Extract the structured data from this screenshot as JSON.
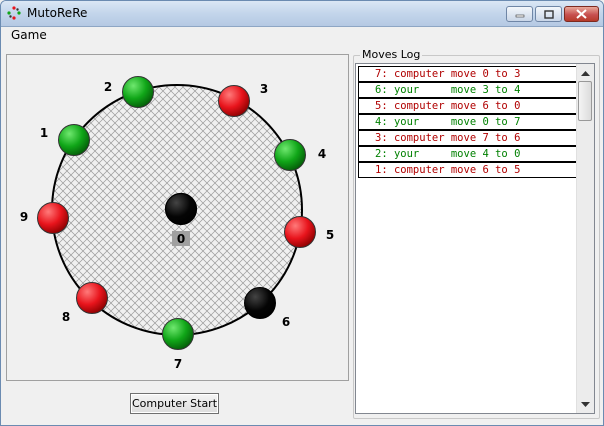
{
  "window": {
    "title": "MutoReRe"
  },
  "menu": {
    "items": [
      "Game"
    ]
  },
  "board": {
    "center_label": "0",
    "center_color": "black",
    "nodes": [
      {
        "label": "1",
        "color": "green"
      },
      {
        "label": "2",
        "color": "green"
      },
      {
        "label": "3",
        "color": "red"
      },
      {
        "label": "4",
        "color": "green"
      },
      {
        "label": "5",
        "color": "red"
      },
      {
        "label": "6",
        "color": "black"
      },
      {
        "label": "7",
        "color": "green"
      },
      {
        "label": "8",
        "color": "red"
      },
      {
        "label": "9",
        "color": "red"
      }
    ]
  },
  "buttons": {
    "start_label": "Computer Start"
  },
  "log": {
    "title": "Moves Log",
    "entries": [
      {
        "text": "7: computer move 0 to 3",
        "color": "#b00000"
      },
      {
        "text": "6: your     move 3 to 4",
        "color": "#008000"
      },
      {
        "text": "5: computer move 6 to 0",
        "color": "#b00000"
      },
      {
        "text": "4: your     move 0 to 7",
        "color": "#008000"
      },
      {
        "text": "3: computer move 7 to 6",
        "color": "#b00000"
      },
      {
        "text": "2: your     move 4 to 0",
        "color": "#008000"
      },
      {
        "text": "1: computer move 6 to 5",
        "color": "#b00000"
      }
    ]
  },
  "colors": {
    "red": "#e8141c",
    "green": "#10a618",
    "black": "#000000"
  }
}
